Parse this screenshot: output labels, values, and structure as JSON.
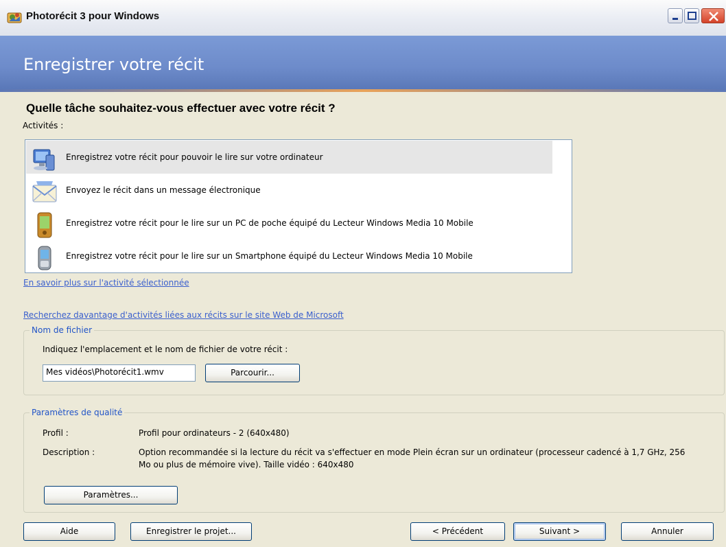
{
  "window": {
    "title": "Photorécit 3 pour Windows",
    "icon": "photorecit-app-icon"
  },
  "header": {
    "title": "Enregistrer votre récit"
  },
  "main": {
    "question": "Quelle tâche souhaitez-vous effectuer avec votre récit ?",
    "activities_label": "Activités :",
    "activities": [
      {
        "label": "Enregistrez votre récit pour pouvoir le lire sur votre ordinateur",
        "icon": "computer-icon",
        "selected": true
      },
      {
        "label": "Envoyez le récit dans un message électronique",
        "icon": "envelope-icon",
        "selected": false
      },
      {
        "label": "Enregistrez votre récit pour le lire sur un PC de poche équipé du Lecteur Windows Media 10 Mobile",
        "icon": "pocket-pc-icon",
        "selected": false
      },
      {
        "label": "Enregistrez votre récit pour le lire sur un Smartphone équipé du Lecteur Windows Media 10 Mobile",
        "icon": "smartphone-icon",
        "selected": false
      }
    ],
    "learn_more_link": "En savoir plus sur l'activité sélectionnée",
    "search_more_link": "Recherchez davantage d'activités liées aux récits sur le site Web de Microsoft"
  },
  "file_group": {
    "legend": "Nom de fichier",
    "instruction": "Indiquez l'emplacement et le nom de fichier de votre récit :",
    "file_value": "Mes vidéos\\Photorécit1.wmv",
    "browse_label": "Parcourir..."
  },
  "quality_group": {
    "legend": "Paramètres de qualité",
    "profile_label": "Profil :",
    "profile_value": "Profil pour ordinateurs - 2 (640x480)",
    "description_label": "Description :",
    "description_value": "Option recommandée si la lecture du récit va s'effectuer en mode Plein écran sur un ordinateur (processeur cadencé à 1,7 GHz, 256 Mo ou plus de mémoire vive). Taille vidéo : 640x480",
    "settings_label": "Paramètres..."
  },
  "footer": {
    "help_label": "Aide",
    "save_project_label": "Enregistrer le projet...",
    "previous_label": "< Précédent",
    "next_label": "Suivant >",
    "cancel_label": "Annuler"
  },
  "colors": {
    "header_blue": "#6d8bca",
    "link_blue": "#3a5fcd",
    "legend_blue": "#2154c7",
    "dialog_bg": "#ece9d8"
  }
}
